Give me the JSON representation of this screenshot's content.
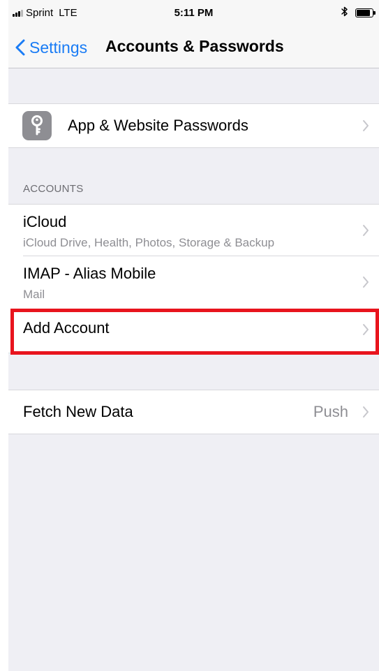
{
  "status_bar": {
    "carrier": "Sprint",
    "network": "LTE",
    "time": "5:11 PM",
    "battery_level": 0.85,
    "icons": [
      "signal-icon",
      "bluetooth-icon",
      "battery-icon"
    ]
  },
  "nav": {
    "back_label": "Settings",
    "title": "Accounts & Passwords"
  },
  "passwords_row": {
    "icon": "key-icon",
    "label": "App & Website Passwords"
  },
  "accounts": {
    "header": "ACCOUNTS",
    "items": [
      {
        "title": "iCloud",
        "subtitle": "iCloud Drive, Health, Photos, Storage & Backup"
      },
      {
        "title": "IMAP - Alias Mobile",
        "subtitle": "Mail"
      }
    ],
    "add_label": "Add Account"
  },
  "fetch": {
    "label": "Fetch New Data",
    "value": "Push"
  },
  "colors": {
    "accent": "#1a7cf5",
    "highlight": "#e8141d",
    "background": "#efeff4"
  }
}
